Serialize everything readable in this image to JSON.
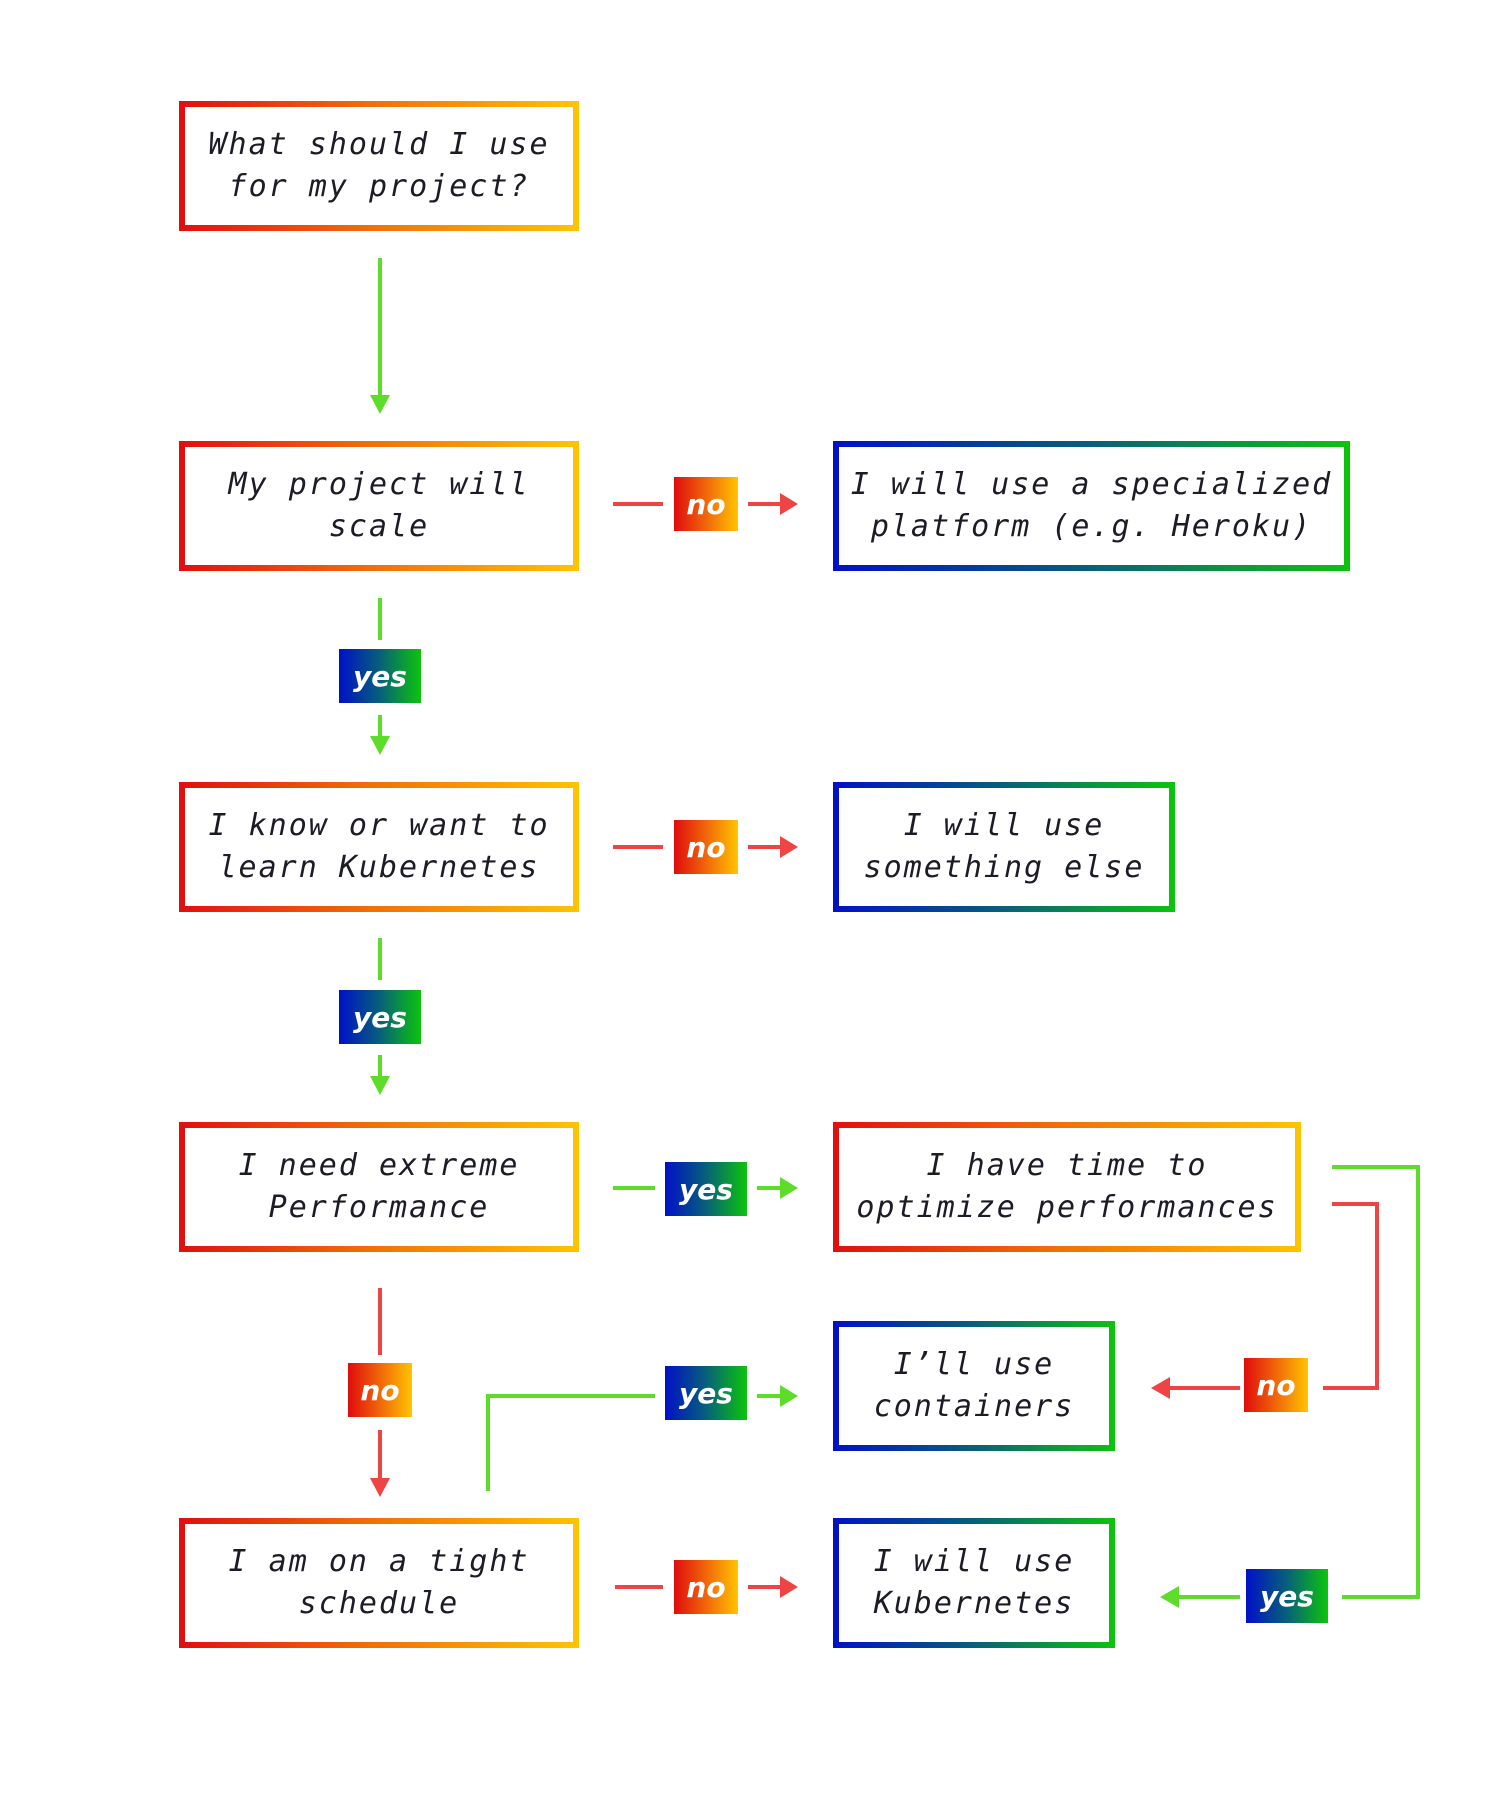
{
  "colors": {
    "yes_edge": "#5ddc2a",
    "no_edge": "#ef4444",
    "text": "#1c1c26",
    "warm_gradient": [
      "#e10e10",
      "#f06a08",
      "#ffc400"
    ],
    "cool_gradient": [
      "#0010c8",
      "#07607a",
      "#0cc40c"
    ]
  },
  "nodes": {
    "start": "What should I use\nfor my project?",
    "scale": "My project will\nscale",
    "kubernetes_knowledge": "I know or want to\nlearn Kubernetes",
    "extreme_perf": "I need extreme\nPerformance",
    "tight_schedule": "I am on a tight\nschedule",
    "specialized_platform": "I will use a specialized\nplatform (e.g. Heroku)",
    "something_else": "I will use\nsomething else",
    "time_to_optimize": "I have time to\noptimize performances",
    "containers": "I’ll use\ncontainers",
    "use_kubernetes": "I will use\nKubernetes"
  },
  "labels": {
    "scale_no": "no",
    "scale_yes": "yes",
    "k8s_no": "no",
    "k8s_yes": "yes",
    "perf_yes": "yes",
    "perf_no": "no",
    "time_no": "no",
    "time_yes": "yes",
    "schedule_yes": "yes",
    "schedule_no": "no"
  },
  "edges": [
    {
      "from": "start",
      "to": "scale",
      "type": "yes",
      "label": null
    },
    {
      "from": "scale",
      "to": "specialized_platform",
      "type": "no",
      "label": "no"
    },
    {
      "from": "scale",
      "to": "kubernetes_knowledge",
      "type": "yes",
      "label": "yes"
    },
    {
      "from": "kubernetes_knowledge",
      "to": "something_else",
      "type": "no",
      "label": "no"
    },
    {
      "from": "kubernetes_knowledge",
      "to": "extreme_perf",
      "type": "yes",
      "label": "yes"
    },
    {
      "from": "extreme_perf",
      "to": "time_to_optimize",
      "type": "yes",
      "label": "yes"
    },
    {
      "from": "extreme_perf",
      "to": "tight_schedule",
      "type": "no",
      "label": "no"
    },
    {
      "from": "time_to_optimize",
      "to": "containers",
      "type": "no",
      "label": "no"
    },
    {
      "from": "time_to_optimize",
      "to": "use_kubernetes",
      "type": "yes",
      "label": "yes"
    },
    {
      "from": "tight_schedule",
      "to": "containers",
      "type": "yes",
      "label": "yes"
    },
    {
      "from": "tight_schedule",
      "to": "use_kubernetes",
      "type": "no",
      "label": "no"
    }
  ]
}
